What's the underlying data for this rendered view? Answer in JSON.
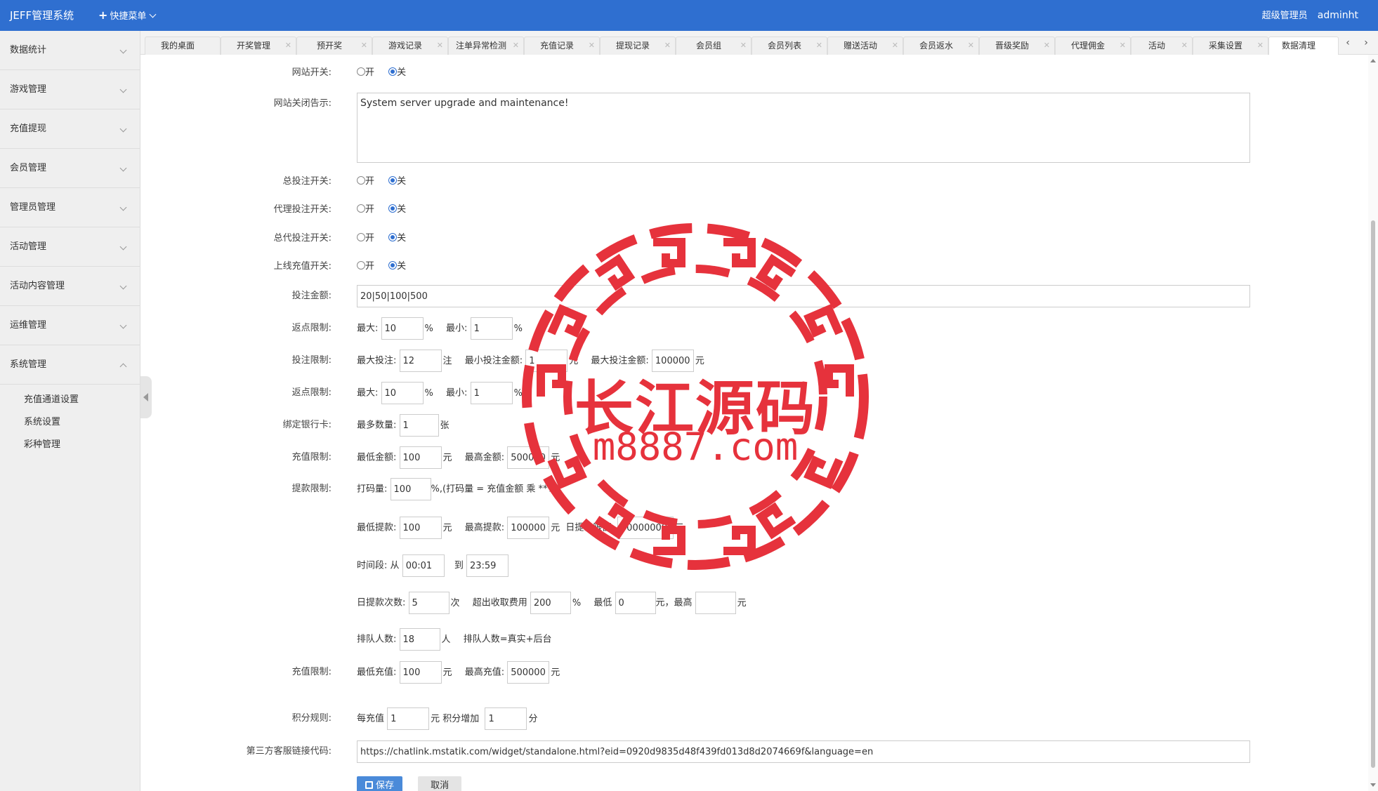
{
  "app": {
    "title": "JEFF管理系统",
    "quick_menu": "快捷菜单",
    "role": "超级管理员",
    "username": "adminht"
  },
  "sidebar": {
    "items": [
      {
        "label": "数据统计"
      },
      {
        "label": "游戏管理"
      },
      {
        "label": "充值提现"
      },
      {
        "label": "会员管理"
      },
      {
        "label": "管理员管理"
      },
      {
        "label": "活动管理"
      },
      {
        "label": "活动内容管理"
      },
      {
        "label": "运维管理"
      },
      {
        "label": "系统管理"
      }
    ],
    "subitems": [
      {
        "label": "充值通道设置"
      },
      {
        "label": "系统设置"
      },
      {
        "label": "彩种管理"
      }
    ]
  },
  "tabs": [
    {
      "label": "我的桌面"
    },
    {
      "label": "开奖管理"
    },
    {
      "label": "预开奖"
    },
    {
      "label": "游戏记录"
    },
    {
      "label": "注单异常检测"
    },
    {
      "label": "充值记录"
    },
    {
      "label": "提现记录"
    },
    {
      "label": "会员组"
    },
    {
      "label": "会员列表"
    },
    {
      "label": "赠送活动"
    },
    {
      "label": "会员返水"
    },
    {
      "label": "晋级奖励"
    },
    {
      "label": "代理佣金"
    },
    {
      "label": "活动"
    },
    {
      "label": "采集设置"
    },
    {
      "label": "数据清理"
    }
  ],
  "tab_nav": {
    "prev": "‹",
    "next": "›"
  },
  "radio": {
    "on": "开",
    "off": "关"
  },
  "form": {
    "site_switch": {
      "label": "网站开关:"
    },
    "close_notice": {
      "label": "网站关闭告示:",
      "value": "System server upgrade and maintenance!"
    },
    "total_bet_switch": {
      "label": "总投注开关:"
    },
    "agent_bet_switch": {
      "label": "代理投注开关:"
    },
    "general_agent_bet_switch": {
      "label": "总代投注开关:"
    },
    "online_recharge_switch": {
      "label": "上线充值开关:"
    },
    "bet_amount": {
      "label": "投注金额:",
      "value": "20|50|100|500"
    },
    "rebate_limit_1": {
      "label": "返点限制:",
      "max_label": "最大:",
      "max": "10",
      "unit": "%",
      "min_label": "最小:",
      "min": "1"
    },
    "bet_limit": {
      "label": "投注限制:",
      "max_bets_label": "最大投注:",
      "max_bets": "12",
      "bets_unit": "注",
      "min_amount_label": "最小投注金额:",
      "min_amount": "1",
      "yuan": "元",
      "max_amount_label": "最大投注金额:",
      "max_amount": "100000"
    },
    "rebate_limit_2": {
      "label": "返点限制:",
      "max_label": "最大:",
      "max": "10",
      "unit": "%",
      "min_label": "最小:",
      "min": "1"
    },
    "bind_bank": {
      "label": "绑定银行卡:",
      "max_label": "最多数量:",
      "max": "1",
      "unit": "张"
    },
    "recharge_limit_1": {
      "label": "充值限制:",
      "min_label": "最低金额:",
      "min": "100",
      "yuan": "元",
      "max_label": "最高金额:",
      "max": "500000"
    },
    "withdraw_limit": {
      "label": "提款限制:",
      "turnover_label": "打码量:",
      "turnover": "100",
      "turnover_note": "%,(打码量 = 充值金额 乘 **%)",
      "min_label": "最低提款:",
      "min": "100",
      "yuan": "元",
      "max_label": "最高提款:",
      "max": "100000",
      "daily_label": "日提款限额:",
      "daily": "50000000",
      "time_label": "时间段:",
      "from_label": "从",
      "from": "00:01",
      "to_label": "到",
      "to": "23:59",
      "count_label": "日提款次数:",
      "count": "5",
      "count_unit": "次",
      "fee_label": "超出收取费用",
      "fee": "200",
      "fee_unit": "%",
      "fee_min_label": "最低",
      "fee_min": "0",
      "fee_max_label": "元，最高",
      "fee_max": "",
      "queue_label": "排队人数:",
      "queue": "18",
      "queue_unit": "人",
      "queue_note": "排队人数=真实+后台"
    },
    "recharge_limit_2": {
      "label": "充值限制:",
      "min_label": "最低充值:",
      "min": "100",
      "yuan": "元",
      "max_label": "最高充值:",
      "max": "500000"
    },
    "points_rule": {
      "label": "积分规则:",
      "per_label": "每充值",
      "per": "1",
      "per_unit": "元 积分增加",
      "add": "1",
      "add_unit": "分"
    },
    "support_link": {
      "label": "第三方客服链接代码:",
      "value": "https://chatlink.mstatik.com/widget/standalone.html?eid=0920d9835d48f439fd013d8d2074669f&language=en"
    }
  },
  "buttons": {
    "save": "保存",
    "cancel": "取消"
  },
  "watermark": {
    "text_cn": "长江源码",
    "text_url": "m8887.com",
    "color": "#e6323c"
  },
  "colors": {
    "header": "#2f6fd0",
    "save_button": "#4a8ad9"
  }
}
